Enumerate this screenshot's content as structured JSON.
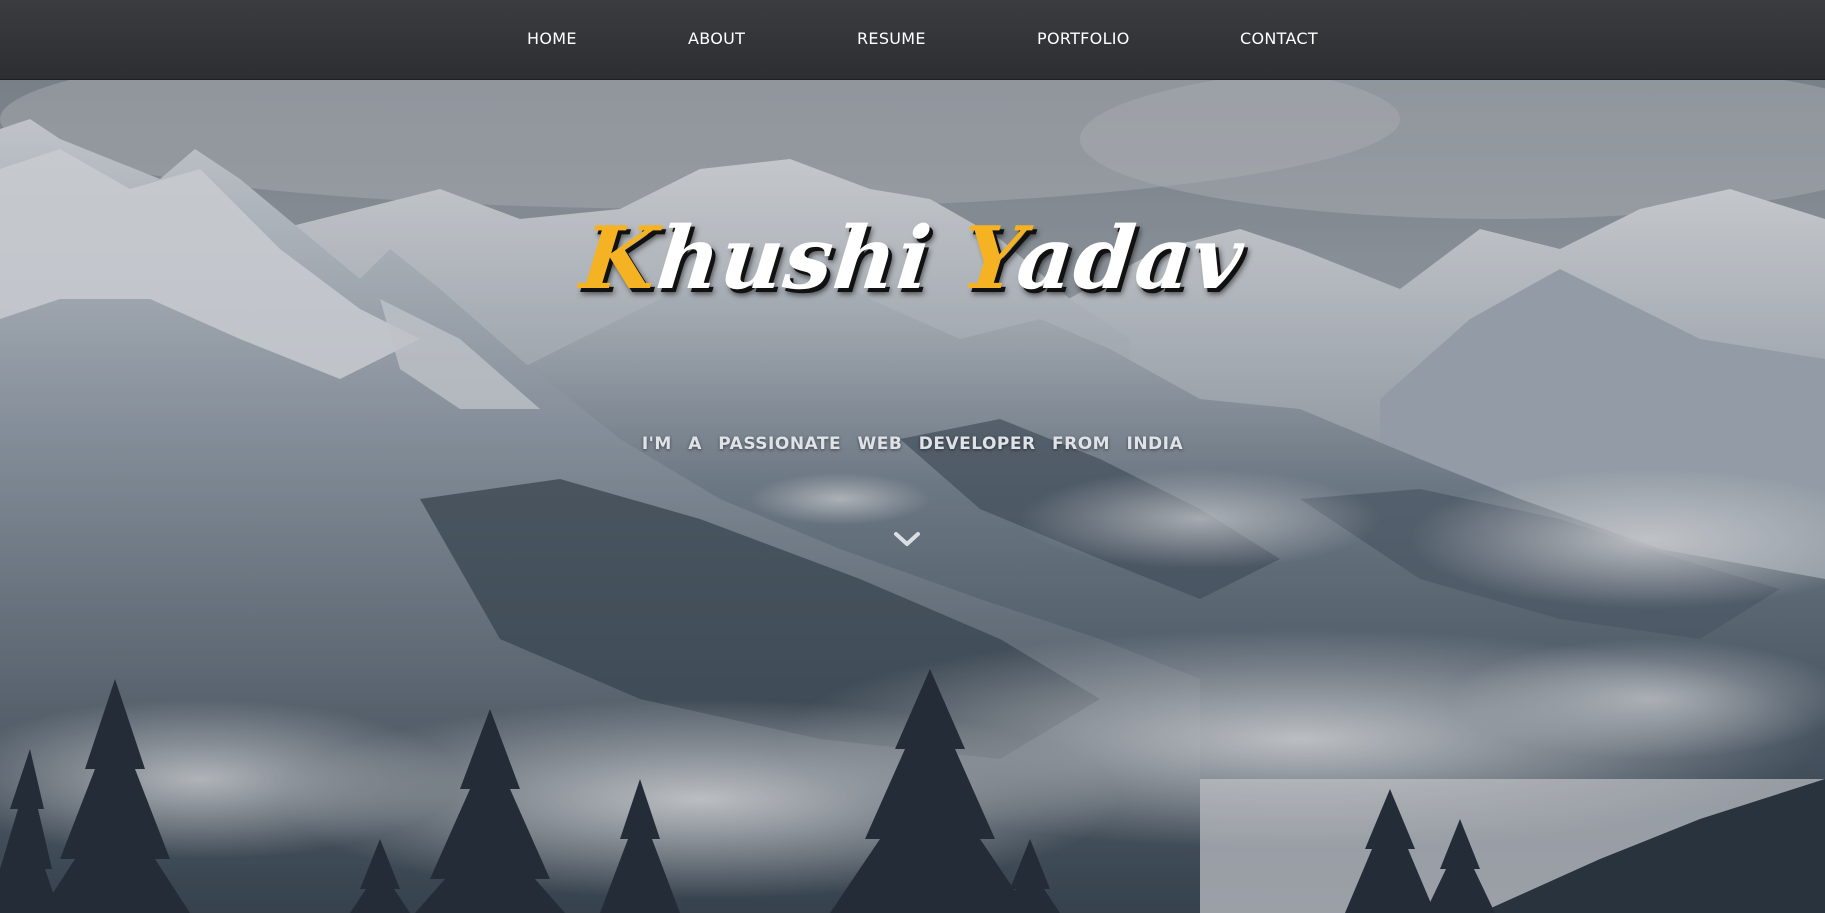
{
  "nav": {
    "items": [
      {
        "label": "HOME"
      },
      {
        "label": "ABOUT"
      },
      {
        "label": "RESUME"
      },
      {
        "label": "PORTFOLIO"
      },
      {
        "label": "CONTACT"
      }
    ]
  },
  "banner": {
    "name_first_initial": "K",
    "name_first_rest": "hushi ",
    "name_last_initial": "Y",
    "name_last_rest": "adav",
    "subtitle": "I'M A PASSIONATE WEB DEVELOPER FROM INDIA",
    "scroll_icon": "chevron-down-icon"
  },
  "colors": {
    "navbar": "#2e3033",
    "accent": "#f5b324",
    "title_text": "#ffffff",
    "subtitle_text": "#dfe3e8"
  }
}
